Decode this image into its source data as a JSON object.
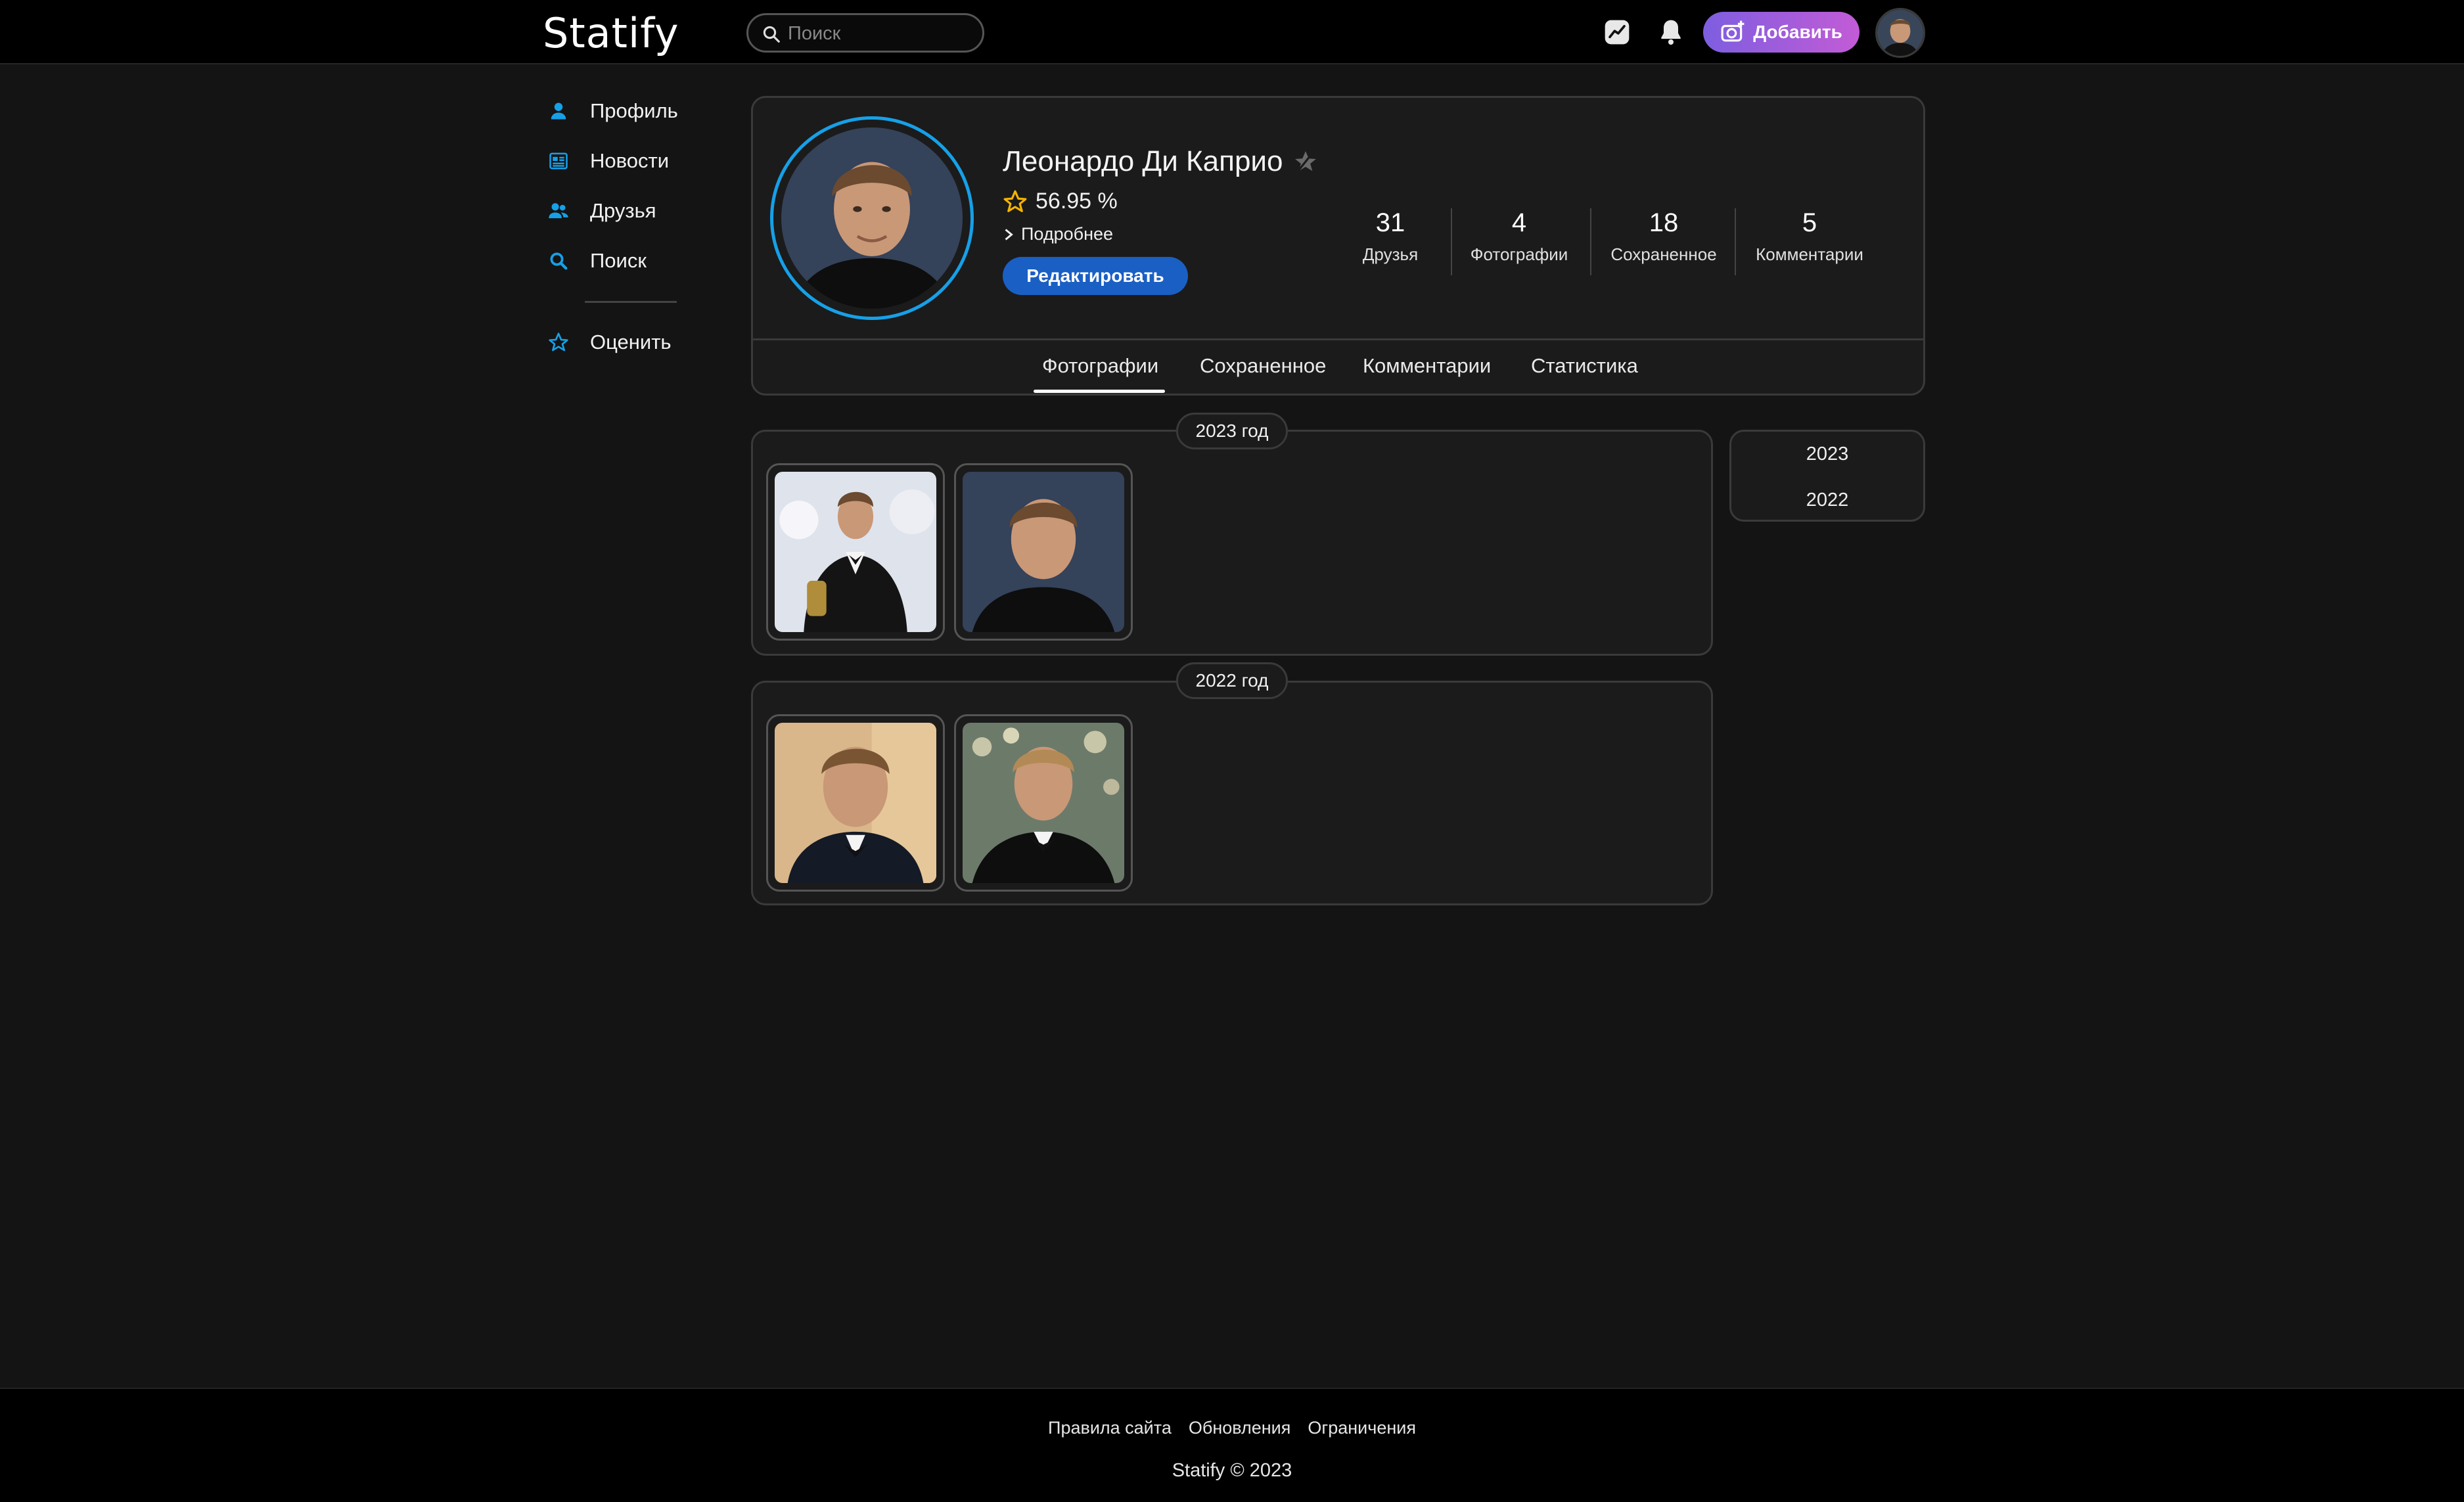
{
  "header": {
    "logo": "Statify",
    "search_placeholder": "Поиск",
    "add_button": "Добавить"
  },
  "sidebar": {
    "items": [
      {
        "label": "Профиль",
        "icon": "user-icon"
      },
      {
        "label": "Новости",
        "icon": "news-icon"
      },
      {
        "label": "Друзья",
        "icon": "friends-icon"
      },
      {
        "label": "Поиск",
        "icon": "search-icon"
      }
    ],
    "rate": {
      "label": "Оценить",
      "icon": "star-outline-icon"
    }
  },
  "profile": {
    "name": "Леонардо Ди Каприо",
    "rating": "56.95 %",
    "more": "Подробнее",
    "edit_button": "Редактировать",
    "stats": [
      {
        "num": "31",
        "label": "Друзья"
      },
      {
        "num": "4",
        "label": "Фотографии"
      },
      {
        "num": "18",
        "label": "Сохраненное"
      },
      {
        "num": "5",
        "label": "Комментарии"
      }
    ],
    "tabs": [
      "Фотографии",
      "Сохраненное",
      "Комментарии",
      "Статистика"
    ],
    "active_tab": "Фотографии"
  },
  "photos": {
    "sections": [
      {
        "year_label": "2023 год",
        "count": 2
      },
      {
        "year_label": "2022 год",
        "count": 2
      }
    ]
  },
  "year_nav": [
    "2023",
    "2022"
  ],
  "footer": {
    "links": [
      "Правила сайта",
      "Обновления",
      "Ограничения"
    ],
    "copyright": "Statify © 2023"
  },
  "colors": {
    "accent": "#16a0e8",
    "edit_button": "#1a5fc4",
    "add_gradient_start": "#7d5ee0",
    "add_gradient_end": "#c35bd6",
    "rating_star": "#f5b400"
  }
}
